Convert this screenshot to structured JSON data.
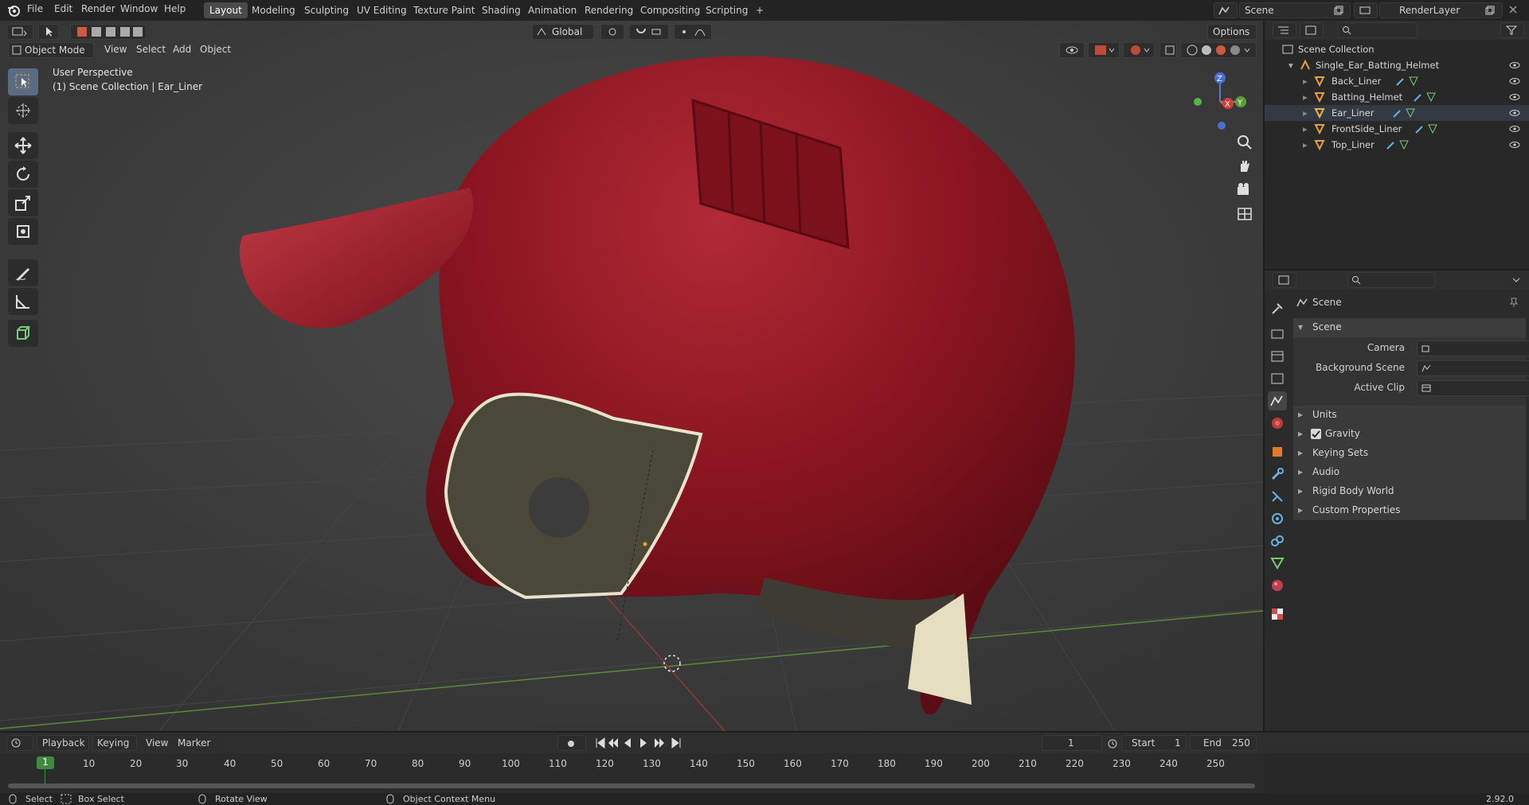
{
  "topbar": {
    "menus": [
      "File",
      "Edit",
      "Render",
      "Window",
      "Help"
    ],
    "workspaces": [
      "Layout",
      "Modeling",
      "Sculpting",
      "UV Editing",
      "Texture Paint",
      "Shading",
      "Animation",
      "Rendering",
      "Compositing",
      "Scripting"
    ],
    "active_workspace": "Layout",
    "add_tab": "+",
    "scene_name": "Scene",
    "render_layer": "RenderLayer"
  },
  "viewport": {
    "mode": "Object Mode",
    "menus": [
      "View",
      "Select",
      "Add",
      "Object"
    ],
    "transform_orientation": "Global",
    "options_label": "Options",
    "overlay_title": "User Perspective",
    "overlay_subtitle": "(1) Scene Collection | Ear_Liner",
    "axes": {
      "z": "Z",
      "y": "Y",
      "x": "X"
    },
    "helmet_color": "#8c1622"
  },
  "outliner": {
    "root": "Scene Collection",
    "object": "Single_Ear_Batting_Helmet",
    "children": [
      "Back_Liner",
      "Batting_Helmet",
      "Ear_Liner",
      "FrontSide_Liner",
      "Top_Liner"
    ]
  },
  "properties": {
    "header": "Scene",
    "panel_title": "Scene",
    "fields": [
      {
        "label": "Camera",
        "value": ""
      },
      {
        "label": "Background Scene",
        "value": ""
      },
      {
        "label": "Active Clip",
        "value": ""
      }
    ],
    "sections": [
      "Units",
      "Gravity",
      "Keying Sets",
      "Audio",
      "Rigid Body World",
      "Custom Properties"
    ],
    "gravity_checked": true
  },
  "timeline": {
    "menus": [
      "Playback",
      "Keying",
      "View",
      "Marker"
    ],
    "current_frame": "1",
    "start_label": "Start",
    "start_value": "1",
    "end_label": "End",
    "end_value": "250",
    "ruler": [
      "10",
      "20",
      "30",
      "40",
      "50",
      "60",
      "70",
      "80",
      "90",
      "100",
      "110",
      "120",
      "130",
      "140",
      "150",
      "160",
      "170",
      "180",
      "190",
      "200",
      "210",
      "220",
      "230",
      "240",
      "250"
    ],
    "playhead_label": "1"
  },
  "statusbar": {
    "select": "Select",
    "box_select": "Box Select",
    "rotate_view": "Rotate View",
    "context_menu": "Object Context Menu",
    "version": "2.92.0"
  }
}
